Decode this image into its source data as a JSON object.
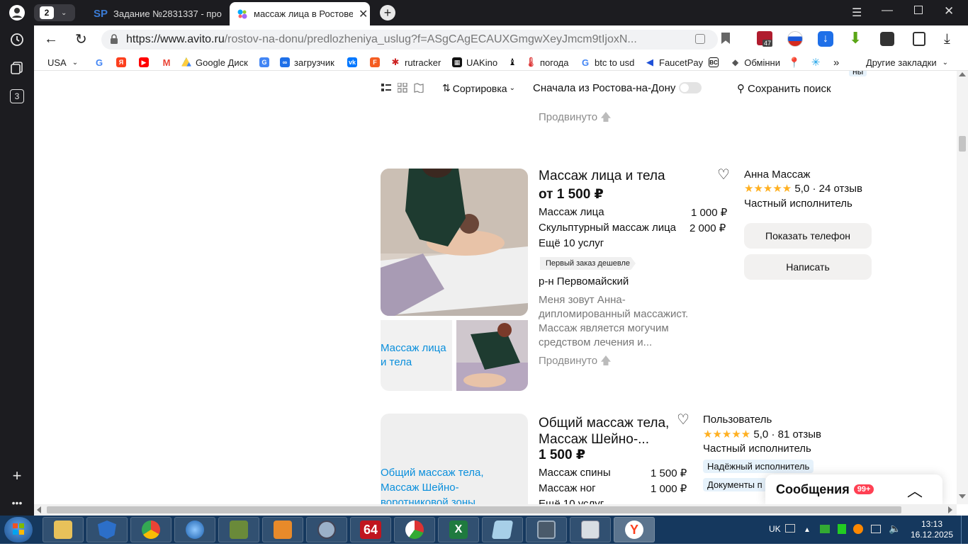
{
  "tabs": {
    "count": "2",
    "items": [
      {
        "label": "Задание №2831337 - про"
      },
      {
        "label": "массаж лица в Ростове"
      }
    ]
  },
  "address": {
    "domain": "https://www.avito.ru",
    "path": "/rostov-na-donu/predlozheniya_uslug?f=ASgCAgECAUXGmgwXeyJmcm9tIjoxN..."
  },
  "extensions": {
    "badge1": "47"
  },
  "sidebar": {
    "counter": "3"
  },
  "bookmarks": {
    "items": [
      {
        "label": "USA"
      },
      {
        "label": "Google Диск"
      },
      {
        "label": "загрузчик"
      },
      {
        "label": "rutracker"
      },
      {
        "label": "UAKino"
      },
      {
        "label": "погода"
      },
      {
        "label": "btc to usd"
      },
      {
        "label": "FaucetPay"
      },
      {
        "label": "Обмінни"
      }
    ],
    "other": "Другие закладки"
  },
  "toolbar": {
    "sort": "Сортировка",
    "rostov_first": "Сначала из Ростова-на-Дону",
    "save_search": "Сохранить поиск",
    "top_badge": "ны"
  },
  "promoted": "Продвинуто",
  "listing1": {
    "title": "Массаж лица и тела",
    "price": "от 1 500 ₽",
    "services": [
      {
        "name": "Массаж лица",
        "price": "1 000 ₽"
      },
      {
        "name": "Скульптурный массаж лица",
        "price": "2 000 ₽"
      }
    ],
    "more": "Ещё 10 услуг",
    "tag": "Первый заказ дешевле",
    "district": "р-н Первомайский",
    "description": "Меня зовут Анна- дипломированный массажист. Массаж является могучим средством лечения и...",
    "img_alt": "Массаж лица и тела",
    "seller": "Анна Массаж",
    "stars": "★★★★★",
    "rating": "5,0",
    "reviews": "24 отзыв",
    "seller_type": "Частный исполнитель",
    "show_phone": "Показать телефон",
    "write": "Написать",
    "promoted": "Продвинуто"
  },
  "listing2": {
    "title": "Общий массаж тела, Массаж Шейно-...",
    "price": "1 500 ₽",
    "services": [
      {
        "name": "Массаж спины",
        "price": "1 500 ₽"
      },
      {
        "name": "Массаж ног",
        "price": "1 000 ₽"
      }
    ],
    "more": "Ещё 10 услуг",
    "img_alt": "Общий массаж тела, Массаж Шейно-воротниковой зоны",
    "seller": "Пользователь",
    "stars": "★★★★★",
    "rating": "5,0",
    "reviews": "81 отзыв",
    "seller_type": "Частный исполнитель",
    "badge1": "Надёжный исполнитель",
    "badge2": "Документы п"
  },
  "messages": {
    "label": "Сообщения",
    "count": "99+"
  },
  "tray": {
    "lang": "UK",
    "time": "13:13",
    "date": "16.12.2025"
  },
  "taskbar": {
    "badge64": "64"
  },
  "colors": {
    "link": "#0a8fdc",
    "star": "#ffb021",
    "badge_red": "#ff4053",
    "accent_blue": "#1e6fe8"
  }
}
